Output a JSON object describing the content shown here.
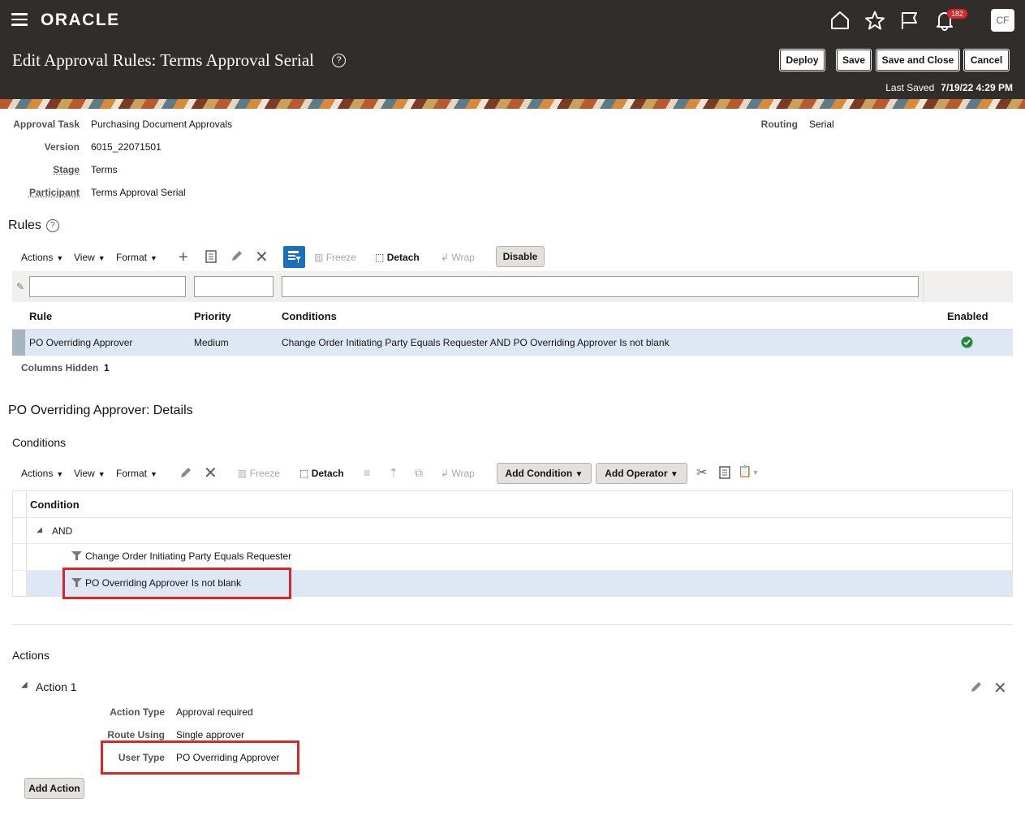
{
  "header": {
    "brand": "ORACLE",
    "notification_count": "182",
    "avatar_initials": "CF",
    "page_title": "Edit Approval Rules: Terms Approval Serial",
    "help_glyph": "?",
    "buttons": {
      "deploy": "Deploy",
      "save": "Save",
      "save_close": "Save and Close",
      "cancel": "Cancel"
    },
    "last_saved_label": "Last Saved",
    "last_saved_value": "7/19/22 4:29 PM",
    "icons": [
      "home-icon",
      "favorites-star-icon",
      "watchlist-flag-icon",
      "notifications-bell-icon"
    ]
  },
  "info": {
    "approval_task_label": "Approval Task",
    "approval_task_value": "Purchasing Document Approvals",
    "version_label": "Version",
    "version_value": "6015_22071501",
    "stage_label": "Stage",
    "stage_value": "Terms",
    "participant_label": "Participant",
    "participant_value": "Terms Approval Serial",
    "routing_label": "Routing",
    "routing_value": "Serial"
  },
  "rules": {
    "title": "Rules",
    "toolbar": {
      "actions": "Actions",
      "view": "View",
      "format": "Format",
      "freeze": "Freeze",
      "detach": "Detach",
      "wrap": "Wrap",
      "disable": "Disable"
    },
    "columns": {
      "rule": "Rule",
      "priority": "Priority",
      "conditions": "Conditions",
      "enabled": "Enabled"
    },
    "rows": [
      {
        "rule": "PO Overriding Approver",
        "priority": "Medium",
        "conditions": "Change Order Initiating Party Equals Requester AND PO Overriding Approver Is not blank",
        "enabled": true
      }
    ],
    "columns_hidden_label": "Columns Hidden",
    "columns_hidden_value": "1"
  },
  "details": {
    "title": "PO Overriding Approver: Details",
    "conditions_title": "Conditions",
    "toolbar": {
      "actions": "Actions",
      "view": "View",
      "format": "Format",
      "freeze": "Freeze",
      "detach": "Detach",
      "wrap": "Wrap",
      "add_condition": "Add Condition",
      "add_operator": "Add Operator"
    },
    "condition_header": "Condition",
    "tree": {
      "operator": "AND",
      "children": [
        "Change Order Initiating Party Equals Requester",
        "PO Overriding Approver Is not blank"
      ]
    },
    "actions_title": "Actions",
    "action1": {
      "title": "Action 1",
      "action_type_label": "Action Type",
      "action_type_value": "Approval required",
      "route_using_label": "Route Using",
      "route_using_value": "Single approver",
      "user_type_label": "User Type",
      "user_type_value": "PO Overriding Approver"
    },
    "add_action": "Add Action"
  },
  "colors": {
    "header_bg": "#312d2a",
    "selected_row": "#dde8f4",
    "highlight_red": "#d9262b",
    "enabled_green": "#1f8a3b",
    "filter_active_blue": "#1a6fc1"
  }
}
